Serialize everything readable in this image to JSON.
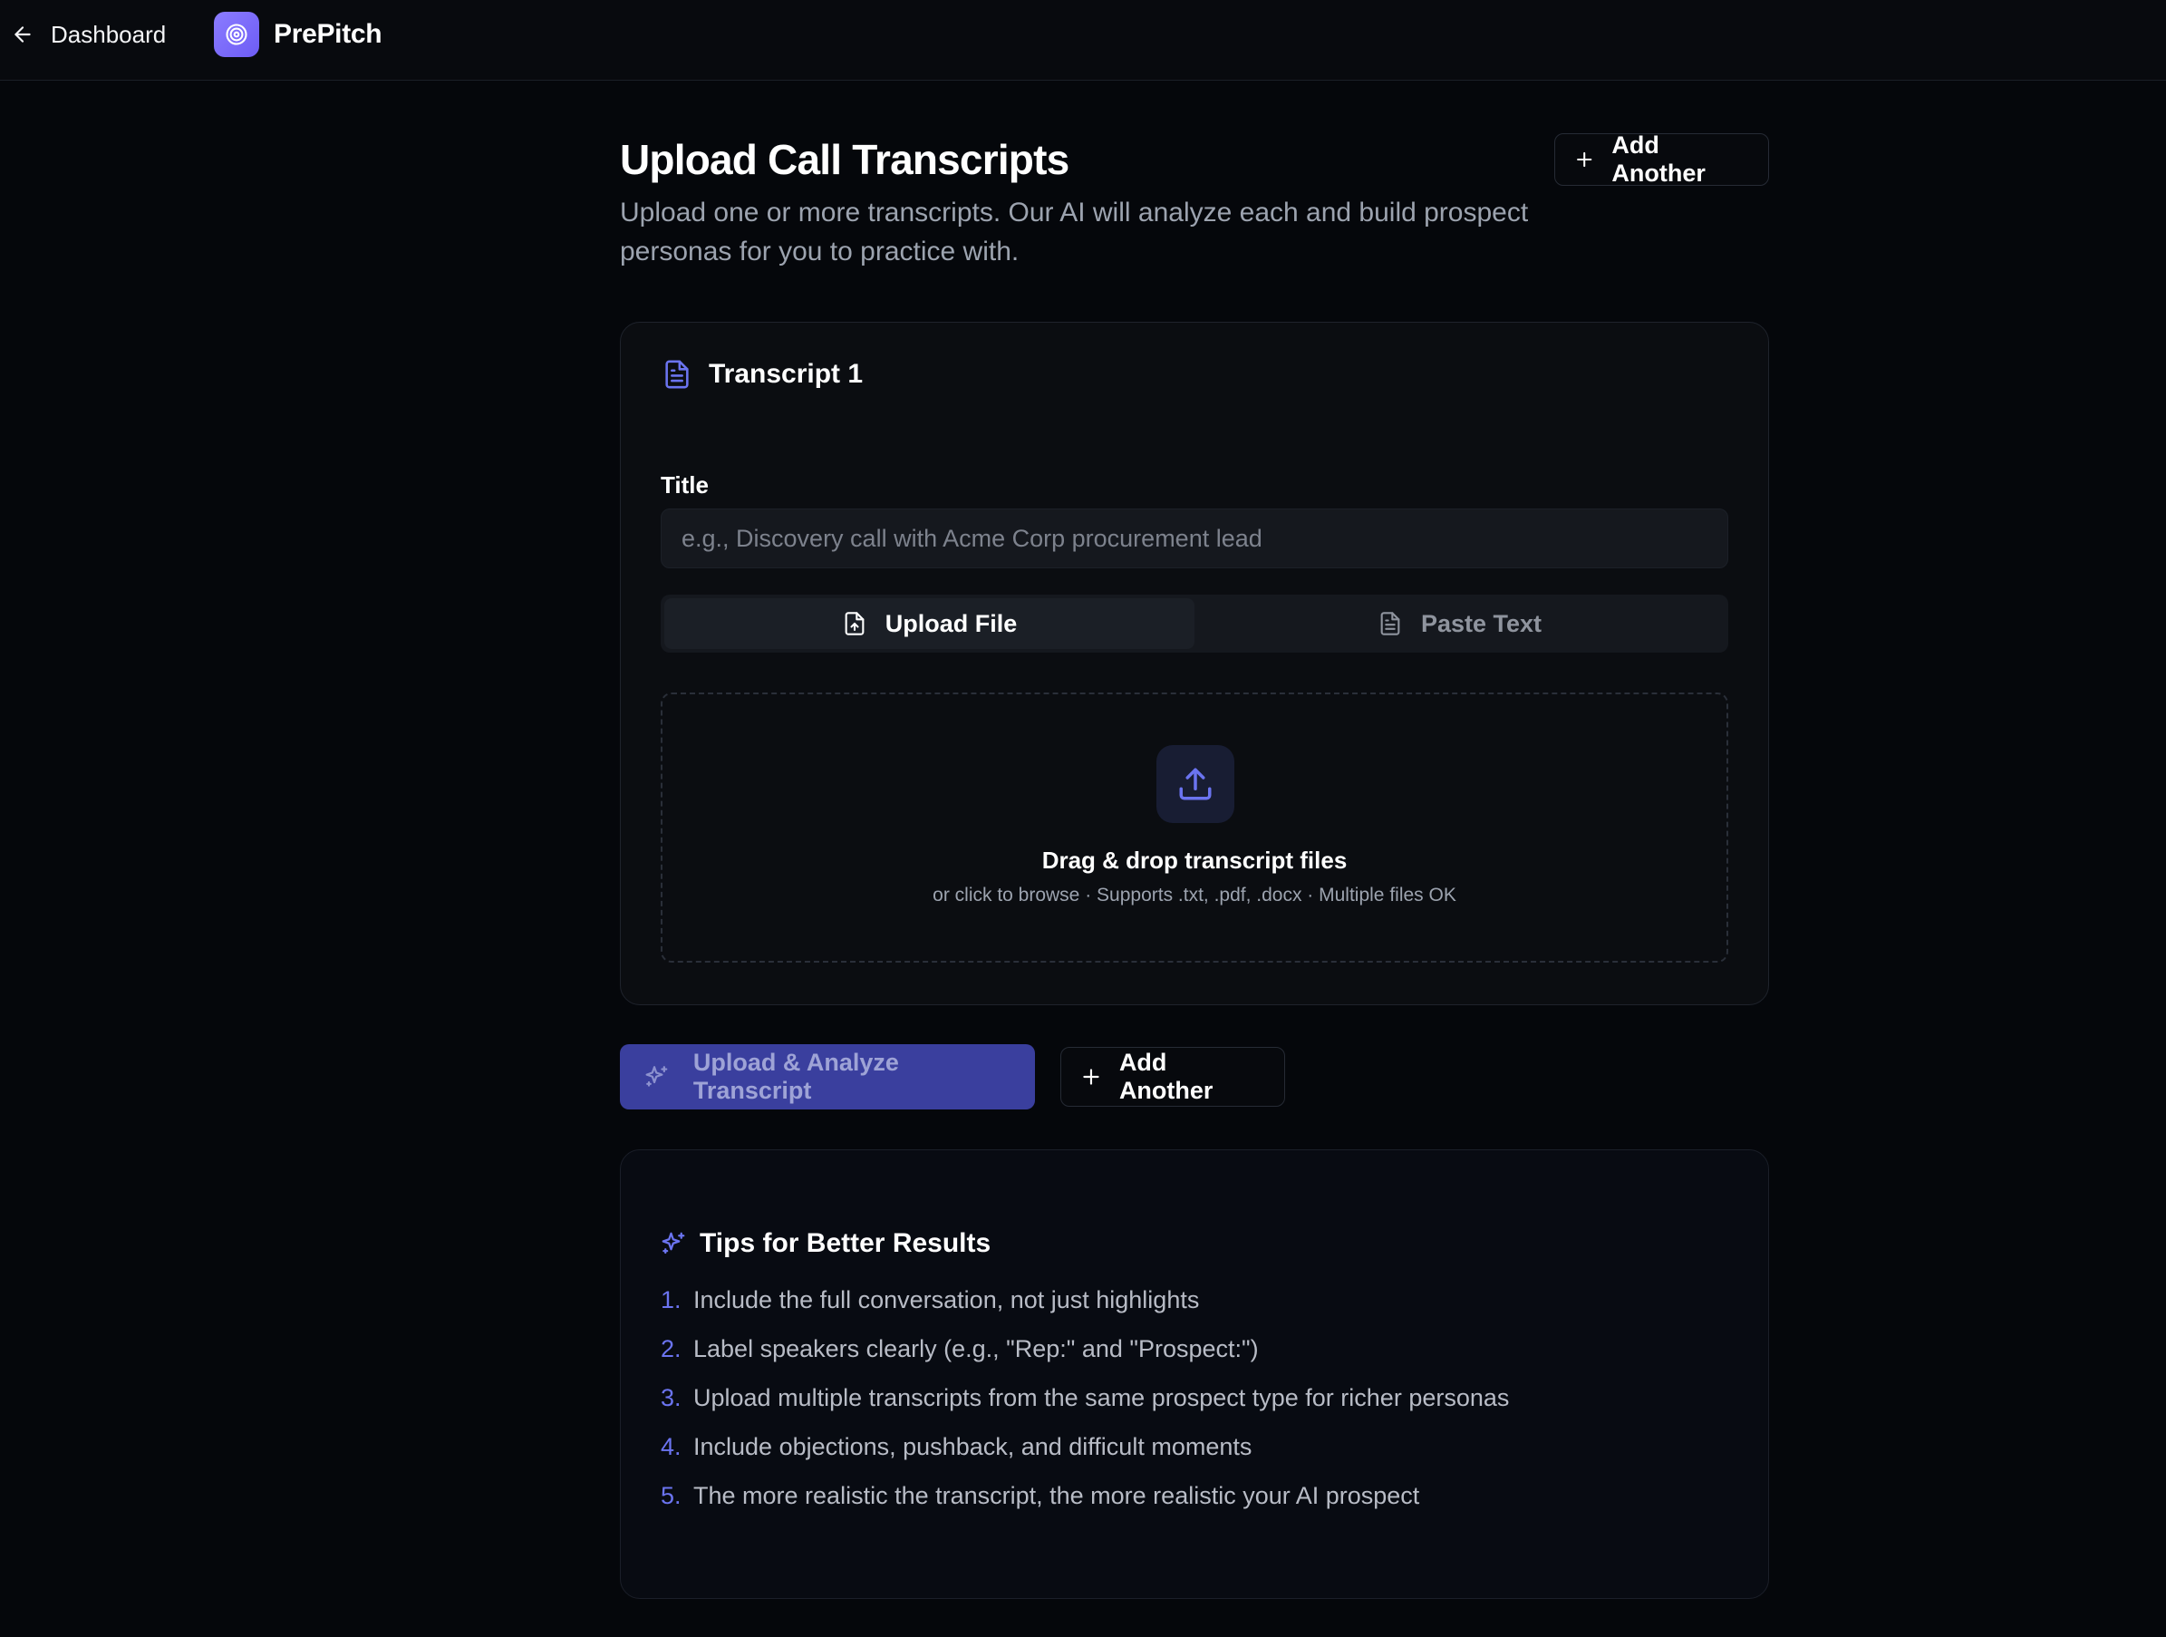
{
  "nav": {
    "back_label": "Dashboard",
    "brand_name": "PrePitch",
    "accent_color": "#7c6cf8"
  },
  "header": {
    "title": "Upload Call Transcripts",
    "subtitle": "Upload one or more transcripts. Our AI will analyze each and build prospect personas for you to practice with.",
    "add_another_label": "Add Another"
  },
  "transcript_card": {
    "title": "Transcript 1",
    "field_label": "Title",
    "title_input": {
      "value": "",
      "placeholder": "e.g., Discovery call with Acme Corp procurement lead"
    },
    "tabs": [
      {
        "label": "Upload File",
        "icon": "file-upload-icon",
        "active": true
      },
      {
        "label": "Paste Text",
        "icon": "file-text-icon",
        "active": false
      }
    ],
    "dropzone": {
      "icon": "upload-icon",
      "title": "Drag & drop transcript files",
      "subtitle": "or click to browse · Supports .txt, .pdf, .docx · Multiple files OK"
    }
  },
  "actions": {
    "primary_label": "Upload & Analyze Transcript",
    "primary_color": "#3a3f9e",
    "add_another_label": "Add Another"
  },
  "tips": {
    "title": "Tips for Better Results",
    "items": [
      {
        "num": "1.",
        "text": "Include the full conversation, not just highlights"
      },
      {
        "num": "2.",
        "text": "Label speakers clearly (e.g., \"Rep:\" and \"Prospect:\")"
      },
      {
        "num": "3.",
        "text": "Upload multiple transcripts from the same prospect type for richer personas"
      },
      {
        "num": "4.",
        "text": "Include objections, pushback, and difficult moments"
      },
      {
        "num": "5.",
        "text": "The more realistic the transcript, the more realistic your AI prospect"
      }
    ]
  }
}
